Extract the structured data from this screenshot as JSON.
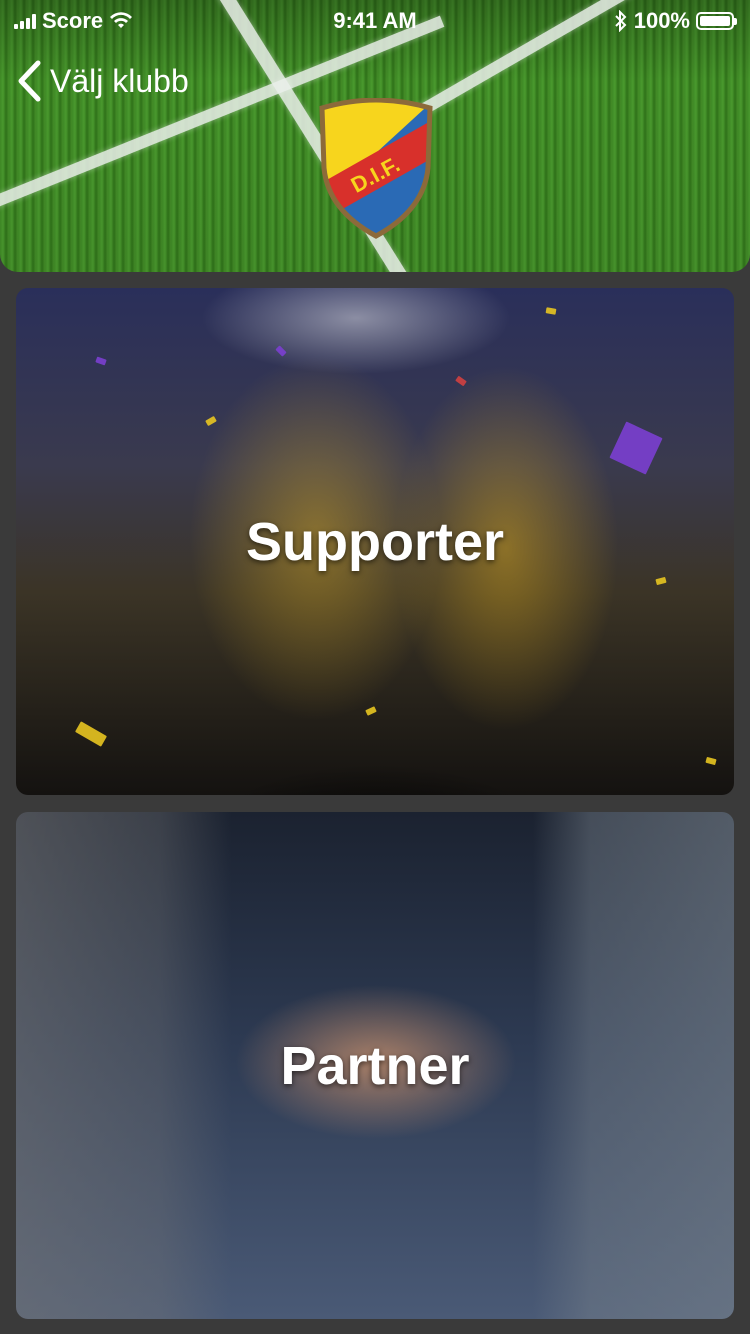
{
  "status_bar": {
    "carrier": "Score",
    "time": "9:41 AM",
    "battery": "100%"
  },
  "nav": {
    "back_label": "Välj klubb"
  },
  "club": {
    "crest_text": "D.I.F."
  },
  "options": [
    {
      "label": "Supporter"
    },
    {
      "label": "Partner"
    }
  ],
  "colors": {
    "crest_yellow": "#f7d51d",
    "crest_red": "#d8302b",
    "crest_blue": "#2a6ab5"
  }
}
